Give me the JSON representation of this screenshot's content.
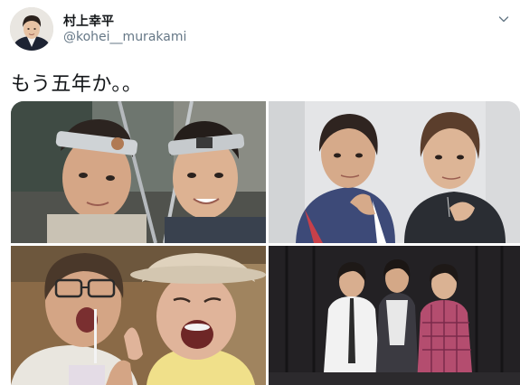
{
  "author": {
    "display_name": "村上幸平",
    "handle": "@kohei__murakami",
    "avatar_icon": "profile-photo"
  },
  "menu": {
    "icon": "chevron-down-icon"
  },
  "tweet": {
    "text": "もう五年か。。"
  },
  "media": {
    "count": 4,
    "photos": [
      {
        "description_icon": "photo-two-men-headbands"
      },
      {
        "description_icon": "photo-two-men-posing"
      },
      {
        "description_icon": "photo-two-people-open-mouths"
      },
      {
        "description_icon": "photo-three-men-stage"
      }
    ]
  },
  "colors": {
    "text": "#14171a",
    "secondary_text": "#657786",
    "background": "#ffffff"
  }
}
